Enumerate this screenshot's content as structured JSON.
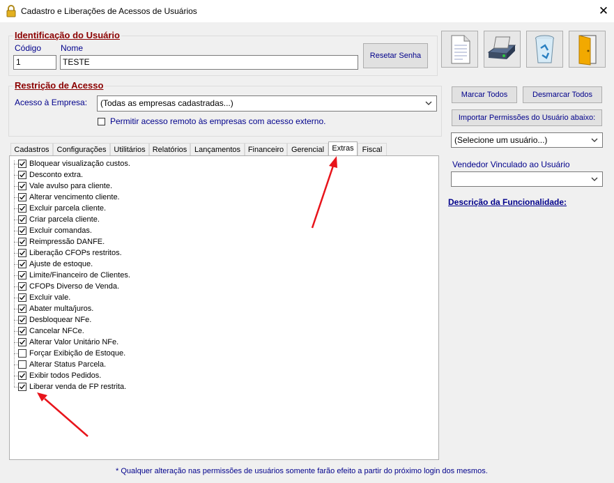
{
  "window": {
    "title": "Cadastro e Liberações de Acessos de Usuários",
    "close_label": "✕"
  },
  "identificacao": {
    "title": "Identificação do Usuário",
    "codigo_label": "Código",
    "codigo_value": "1",
    "nome_label": "Nome",
    "nome_value": "TESTE",
    "reset_button": "Resetar Senha"
  },
  "restricao": {
    "title": "Restrição de Acesso",
    "empresa_label": "Acesso à Empresa:",
    "empresa_value": "(Todas as empresas cadastradas...)",
    "remote_label": "Permitir acesso remoto às empresas com acesso externo."
  },
  "toolbar_icons": [
    "document-icon",
    "floppy-save-icon",
    "recycle-bin-icon",
    "exit-door-icon"
  ],
  "right_panel": {
    "marcar_todos": "Marcar Todos",
    "desmarcar_todos": "Desmarcar Todos",
    "importar": "Importar Permissões do Usuário abaixo:",
    "user_select_value": "(Selecione um usuário...)",
    "vendedor_label": "Vendedor Vinculado ao Usuário",
    "vendedor_value": "",
    "descricao_link": "Descrição da Funcionalidade:"
  },
  "tabs": [
    "Cadastros",
    "Configurações",
    "Utilitários",
    "Relatórios",
    "Lançamentos",
    "Financeiro",
    "Gerencial",
    "Extras",
    "Fiscal"
  ],
  "active_tab": "Extras",
  "permissions": [
    {
      "label": "Bloquear visualização custos.",
      "checked": true
    },
    {
      "label": "Desconto extra.",
      "checked": true
    },
    {
      "label": "Vale avulso para cliente.",
      "checked": true
    },
    {
      "label": "Alterar vencimento cliente.",
      "checked": true
    },
    {
      "label": "Excluir parcela cliente.",
      "checked": true
    },
    {
      "label": "Criar parcela cliente.",
      "checked": true
    },
    {
      "label": "Excluir comandas.",
      "checked": true
    },
    {
      "label": "Reimpressão DANFE.",
      "checked": true
    },
    {
      "label": "Liberação CFOPs restritos.",
      "checked": true
    },
    {
      "label": "Ajuste de estoque.",
      "checked": true
    },
    {
      "label": "Limite/Financeiro de Clientes.",
      "checked": true
    },
    {
      "label": "CFOPs Diverso de Venda.",
      "checked": true
    },
    {
      "label": "Excluir vale.",
      "checked": true
    },
    {
      "label": "Abater multa/juros.",
      "checked": true
    },
    {
      "label": "Desbloquear NFe.",
      "checked": true
    },
    {
      "label": "Cancelar NFCe.",
      "checked": true
    },
    {
      "label": "Alterar Valor Unitário NFe.",
      "checked": true
    },
    {
      "label": "Forçar Exibição de Estoque.",
      "checked": false
    },
    {
      "label": "Alterar Status Parcela.",
      "checked": false
    },
    {
      "label": "Exibir todos Pedidos.",
      "checked": true
    },
    {
      "label": "Liberar venda de FP restrita.",
      "checked": true
    }
  ],
  "footnote": "* Qualquer alteração nas permissões de usuários somente farão efeito a partir do próximo login dos mesmos.",
  "colors": {
    "accent_red": "#8b0000",
    "label_blue": "#00008b",
    "arrow_red": "#e8141b"
  }
}
